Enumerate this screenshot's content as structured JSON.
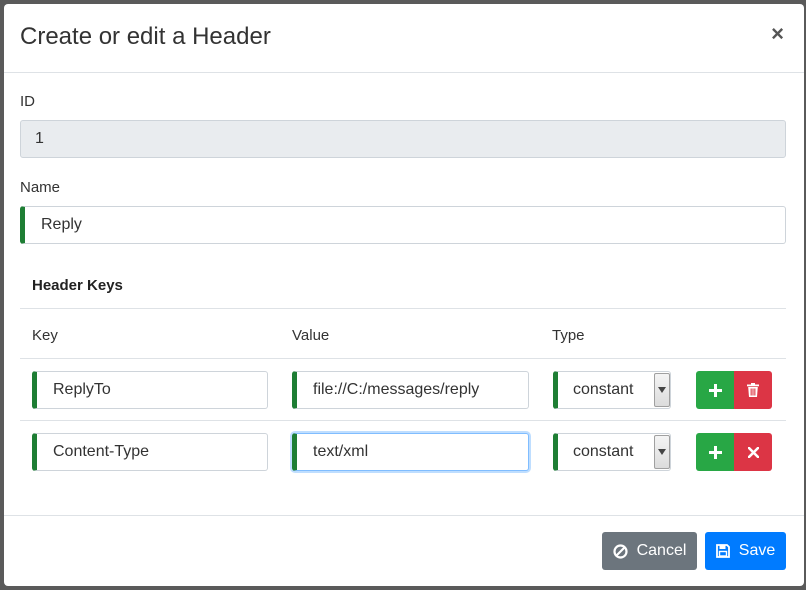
{
  "dialog": {
    "title": "Create or edit a Header",
    "close_label": "×"
  },
  "fields": {
    "id_label": "ID",
    "id_value": "1",
    "name_label": "Name",
    "name_value": "Reply"
  },
  "header_keys": {
    "title": "Header Keys",
    "columns": [
      "Key",
      "Value",
      "Type"
    ],
    "rows": [
      {
        "key": "ReplyTo",
        "value": "file://C:/messages/reply",
        "type": "constant",
        "delete_icon": "trash-icon"
      },
      {
        "key": "Content-Type",
        "value": "text/xml",
        "type": "constant",
        "delete_icon": "times-icon"
      }
    ]
  },
  "footer": {
    "cancel_label": "Cancel",
    "save_label": "Save"
  },
  "colors": {
    "valid_border": "#1e7e34",
    "add_button": "#28a745",
    "delete_button": "#dc3545",
    "cancel_button": "#6c757d",
    "save_button": "#007bff"
  }
}
